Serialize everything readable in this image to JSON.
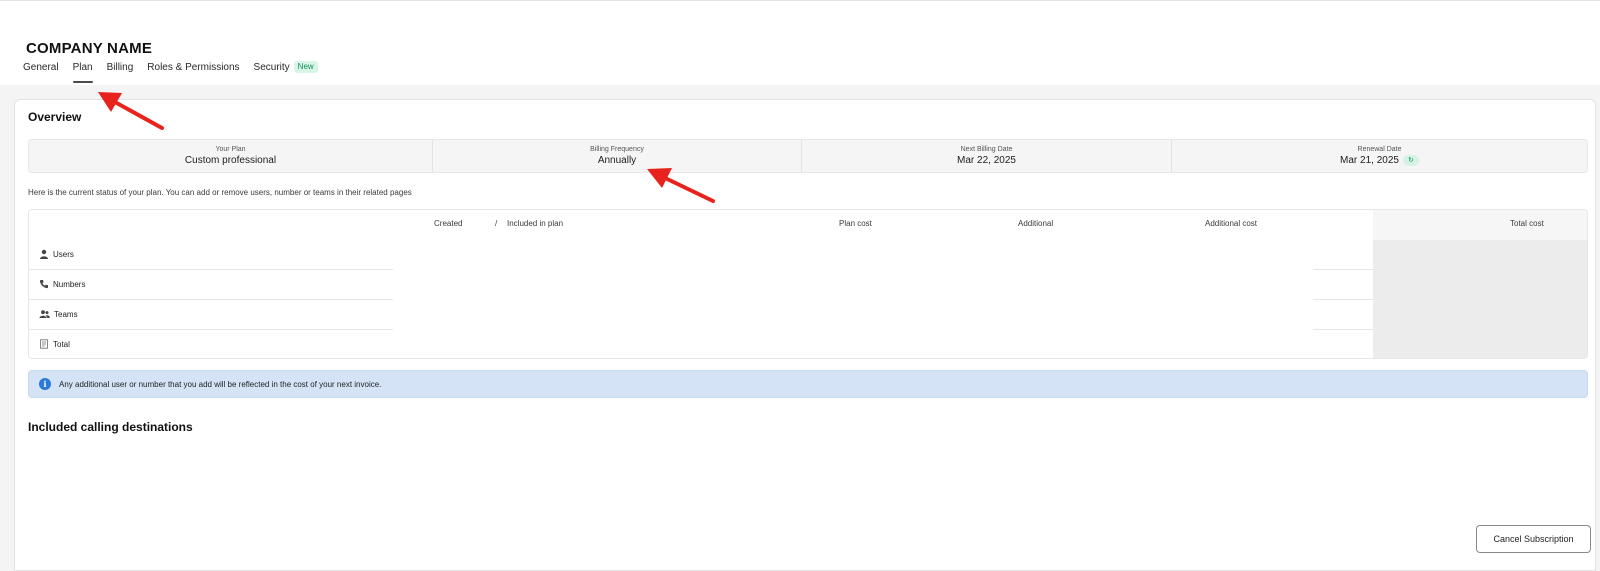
{
  "header": {
    "company_name": "COMPANY NAME",
    "tabs": [
      {
        "label": "General",
        "active": false
      },
      {
        "label": "Plan",
        "active": true
      },
      {
        "label": "Billing",
        "active": false
      },
      {
        "label": "Roles & Permissions",
        "active": false
      },
      {
        "label": "Security",
        "active": false,
        "badge": "New"
      }
    ]
  },
  "overview": {
    "title": "Overview",
    "summary": [
      {
        "label": "Your Plan",
        "value": "Custom professional"
      },
      {
        "label": "Billing Frequency",
        "value": "Annually"
      },
      {
        "label": "Next Billing Date",
        "value": "Mar 22, 2025"
      },
      {
        "label": "Renewal Date",
        "value": "Mar 21, 2025",
        "icon": "renew-icon"
      }
    ],
    "status_text": "Here is the current status of your plan. You can add or remove users, number or teams in their related pages"
  },
  "table": {
    "headers": {
      "created": "Created",
      "separator": "/",
      "included": "Included in plan",
      "plan_cost": "Plan cost",
      "additional": "Additional",
      "additional_cost": "Additional cost",
      "total_cost": "Total cost"
    },
    "rows": [
      {
        "label": "Users",
        "icon": "user-icon"
      },
      {
        "label": "Numbers",
        "icon": "phone-icon"
      },
      {
        "label": "Teams",
        "icon": "team-icon"
      },
      {
        "label": "Total",
        "icon": "receipt-icon"
      }
    ]
  },
  "info_banner": {
    "icon": "info-icon",
    "text": "Any additional user or number that you add will be reflected in the cost of your next invoice.",
    "color": "#d4e4f6"
  },
  "calling": {
    "title": "Included calling destinations"
  },
  "actions": {
    "cancel_label": "Cancel Subscription"
  },
  "annotations": {
    "arrow_color": "#e8231d"
  }
}
